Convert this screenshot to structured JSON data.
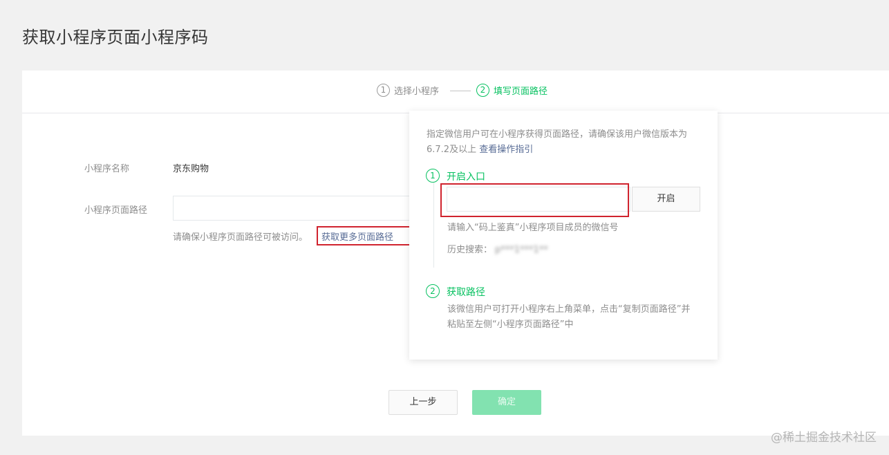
{
  "page": {
    "title": "获取小程序页面小程序码"
  },
  "steps": [
    {
      "num": "1",
      "label": "选择小程序"
    },
    {
      "num": "2",
      "label": "填写页面路径"
    }
  ],
  "form": {
    "name_label": "小程序名称",
    "name_value": "京东购物",
    "path_label": "小程序页面路径",
    "path_value": "",
    "hint": "请确保小程序页面路径可被访问。",
    "more_link": "获取更多页面路径"
  },
  "buttons": {
    "prev": "上一步",
    "confirm": "确定"
  },
  "popover": {
    "desc": "指定微信用户可在小程序获得页面路径，请确保该用户微信版本为6.7.2及以上",
    "guide_link": "查看操作指引",
    "step1": {
      "num": "1",
      "title": "开启入口",
      "input_value": "",
      "button": "开启",
      "hint": "请输入“码上鉴真”小程序项目成员的微信号",
      "history_label": "历史搜索：",
      "history_value": "p***1***1**"
    },
    "step2": {
      "num": "2",
      "title": "获取路径",
      "desc": "该微信用户可打开小程序右上角菜单，点击“复制页面路径”并粘贴至左侧“小程序页面路径”中"
    }
  },
  "watermark": "@稀土掘金技术社区",
  "colors": {
    "accent": "#07c160",
    "link": "#576b95",
    "highlight": "#d0232e"
  }
}
